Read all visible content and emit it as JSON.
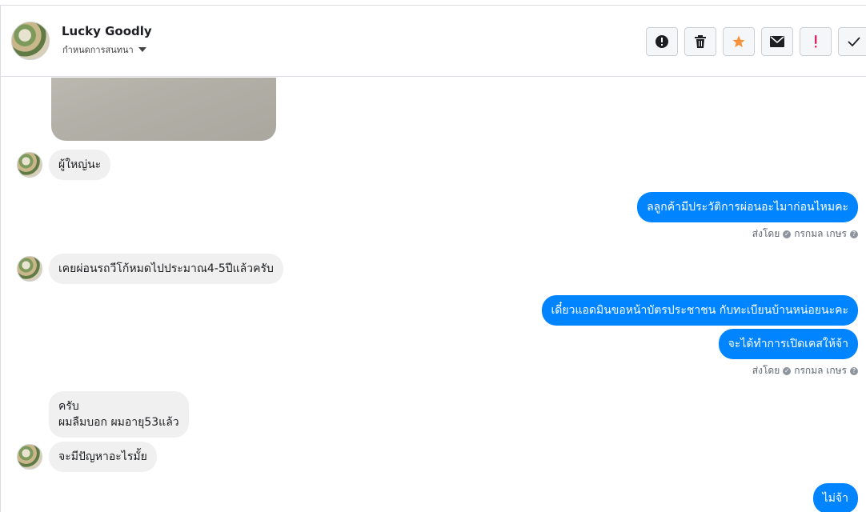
{
  "header": {
    "contact_name": "Lucky Goodly",
    "assign_label": "กำหนดการสนทนา",
    "toolbar": [
      {
        "name": "spam-button",
        "icon": "alert-circle-icon"
      },
      {
        "name": "delete-button",
        "icon": "trash-icon"
      },
      {
        "name": "star-button",
        "icon": "star-icon"
      },
      {
        "name": "mark-unread-button",
        "icon": "envelope-icon"
      },
      {
        "name": "important-button",
        "icon": "exclamation-icon"
      },
      {
        "name": "done-button",
        "icon": "checkmark-icon"
      }
    ]
  },
  "messages": [
    {
      "type": "image",
      "direction": "in"
    },
    {
      "direction": "in",
      "text": "ผู้ใหญ่นะ"
    },
    {
      "direction": "out",
      "text": "ลลูกค้ามีประวัติการผ่อนอะไมาก่อนไหมคะ"
    },
    {
      "type": "sent_by",
      "prefix": "ส่งโดย",
      "name": "กรกมล เกษร"
    },
    {
      "direction": "in",
      "text": "เคยผ่อนรถวีโก้หมดไปประมาณ4-5ปีแล้วครับ"
    },
    {
      "direction": "out",
      "text": "เดี๋ยวแอดมินขอหน้าบัตรประชาชน กับทะเบียนบ้านหน่อยนะคะ"
    },
    {
      "direction": "out",
      "text": "จะได้ทำการเปิดเคสให้จ้า"
    },
    {
      "type": "sent_by",
      "prefix": "ส่งโดย",
      "name": "กรกมล เกษร"
    },
    {
      "direction": "in",
      "lines": [
        "ครับ",
        "ผมลืมบอก ผมอายุ53แล้ว"
      ]
    },
    {
      "direction": "in",
      "text": "จะมีปัญหาอะไรมั้ย"
    },
    {
      "direction": "out",
      "text": "ไม่จ้า"
    }
  ],
  "colors": {
    "accent_blue": "#0084ff",
    "incoming_bubble": "#f0f0f0",
    "star": "#f7923a",
    "important": "#e0245e"
  }
}
